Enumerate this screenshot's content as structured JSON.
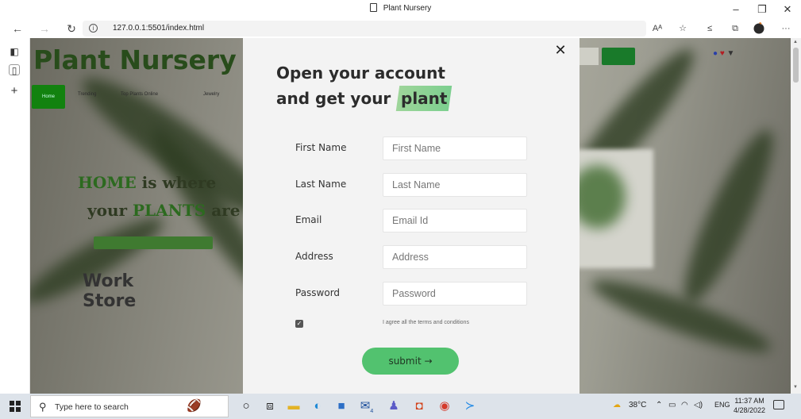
{
  "browser": {
    "tab_title": "Plant Nursery",
    "url": "127.0.0.1:5501/index.html",
    "window_controls": {
      "minimize": "–",
      "restore": "❐",
      "close": "✕"
    },
    "toolbar_icons": [
      "read-aloud-icon",
      "favorite-add-icon",
      "favorites-icon",
      "collections-icon",
      "profile-icon",
      "more-icon"
    ],
    "read_aloud": "Aᴬ",
    "more": "···"
  },
  "page": {
    "logo": "Plant Nursery",
    "nav": {
      "home": "Home",
      "items": [
        "Trending",
        "Top Plants Online",
        "Jewelry"
      ]
    },
    "hero": {
      "line1_a": "HOME",
      "line1_b": " is where",
      "line2_a": "your ",
      "line2_b": "PLANTS",
      "line2_c": " are",
      "line3": "Work",
      "line4": "Store"
    }
  },
  "modal": {
    "close": "✕",
    "heading_line1": "Open your account",
    "heading_line2_prefix": "and get your ",
    "heading_highlight": "plant",
    "fields": [
      {
        "label": "First Name",
        "placeholder": "First Name"
      },
      {
        "label": "Last Name",
        "placeholder": "Last Name"
      },
      {
        "label": "Email",
        "placeholder": "Email Id"
      },
      {
        "label": "Address",
        "placeholder": "Address"
      },
      {
        "label": "Password",
        "placeholder": "Password"
      }
    ],
    "agree_text": "I agree all the terms and conditions",
    "agree_checked": true,
    "submit_label": "submit →"
  },
  "taskbar": {
    "search_placeholder": "Type here to search",
    "apps": [
      "cortana-icon",
      "task-view-icon",
      "file-explorer-icon",
      "edge-icon",
      "store-icon",
      "mail-icon",
      "teams-icon",
      "office-icon",
      "chrome-icon",
      "vscode-icon"
    ],
    "mail_badge": "4",
    "weather": "38°C",
    "language": "ENG",
    "time": "11:37 AM",
    "date": "4/28/2022"
  }
}
